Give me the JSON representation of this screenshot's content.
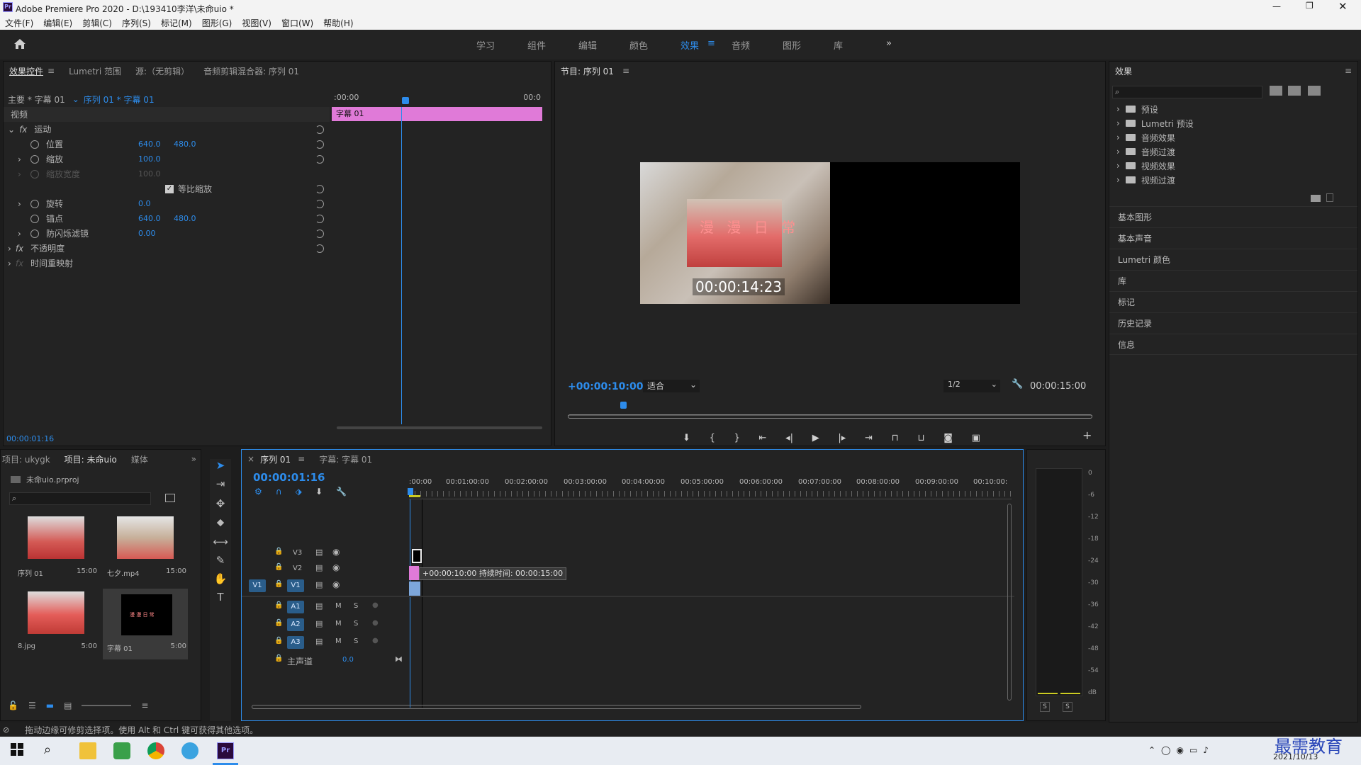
{
  "window": {
    "app_badge": "Pr",
    "title": "Adobe Premiere Pro 2020 - D:\\193410李洋\\未命uio *"
  },
  "menu": [
    "文件(F)",
    "编辑(E)",
    "剪辑(C)",
    "序列(S)",
    "标记(M)",
    "图形(G)",
    "视图(V)",
    "窗口(W)",
    "帮助(H)"
  ],
  "workspaces": [
    "学习",
    "组件",
    "编辑",
    "颜色",
    "效果",
    "音频",
    "图形",
    "库"
  ],
  "active_workspace": "效果",
  "effect_controls": {
    "tabs": [
      "效果控件",
      "Lumetri 范围",
      "源:（无剪辑）",
      "音频剪辑混合器: 序列 01"
    ],
    "master": "主要 * 字幕 01",
    "sequence": "序列 01 * 字幕 01",
    "ruler_start": ":00:00",
    "ruler_end": "00:0",
    "clip_label": "字幕 01",
    "video_label": "视频",
    "motion": "运动",
    "props": [
      {
        "name": "位置",
        "v1": "640.0",
        "v2": "480.0"
      },
      {
        "name": "缩放",
        "v1": "100.0",
        "v2": ""
      },
      {
        "name": "缩放宽度",
        "v1": "100.0",
        "v2": ""
      },
      {
        "name": "等比缩放",
        "v1": "",
        "v2": ""
      },
      {
        "name": "旋转",
        "v1": "0.0",
        "v2": ""
      },
      {
        "name": "锚点",
        "v1": "640.0",
        "v2": "480.0"
      },
      {
        "name": "防闪烁滤镜",
        "v1": "0.00",
        "v2": ""
      }
    ],
    "opacity": "不透明度",
    "remap": "时间重映射",
    "timecode": "00:00:01:16"
  },
  "program": {
    "title": "节目: 序列 01",
    "overlay_text": "漫 漫 日 常",
    "overlay_timecode": "00:00:14:23",
    "timecode": "+00:00:10:00",
    "fit": "适合",
    "res": "1/2",
    "duration": "00:00:15:00",
    "playhead_fraction": 0.1
  },
  "effects_panel": {
    "title": "效果",
    "items": [
      "预设",
      "Lumetri 预设",
      "音频效果",
      "音频过渡",
      "视频效果",
      "视频过渡"
    ],
    "side_links": [
      "基本图形",
      "基本声音",
      "Lumetri 颜色",
      "库",
      "标记",
      "历史记录",
      "信息"
    ]
  },
  "project": {
    "tabs": [
      "项目: ukygk",
      "项目: 未命uio",
      "媒体"
    ],
    "file": "未命uio.prproj",
    "items": [
      {
        "name": "序列 01",
        "dur": "15:00"
      },
      {
        "name": "七夕.mp4",
        "dur": "15:00"
      },
      {
        "name": "8.jpg",
        "dur": "5:00"
      },
      {
        "name": "字幕 01",
        "dur": "5:00"
      }
    ]
  },
  "timeline": {
    "tabs": [
      "序列 01",
      "字幕: 字幕 01"
    ],
    "timecode": "00:00:01:16",
    "ruler": [
      ":00:00",
      "00:01:00:00",
      "00:02:00:00",
      "00:03:00:00",
      "00:04:00:00",
      "00:05:00:00",
      "00:06:00:00",
      "00:07:00:00",
      "00:08:00:00",
      "00:09:00:00",
      "00:10:00:"
    ],
    "video_tracks": [
      "V3",
      "V2",
      "V1"
    ],
    "audio_tracks": [
      "A1",
      "A2",
      "A3"
    ],
    "master": "主声道",
    "master_val": "0.0",
    "tooltip": "+00:00:10:00 持续时间: 00:00:15:00",
    "source_patch": "V1"
  },
  "meter": {
    "scale": [
      "0",
      "-6",
      "-12",
      "-18",
      "-24",
      "-30",
      "-36",
      "-42",
      "-48",
      "-54",
      "dB"
    ],
    "solo": [
      "S",
      "S"
    ]
  },
  "status_text": "拖动边缘可修剪选择项。使用 Alt 和 Ctrl 键可获得其他选项。",
  "taskbar": {
    "date": "2021/10/13",
    "watermark": "最需教育"
  },
  "colors": {
    "accent": "#2d8ceb",
    "clip_pink": "#e07ad8",
    "panel": "#232323"
  }
}
